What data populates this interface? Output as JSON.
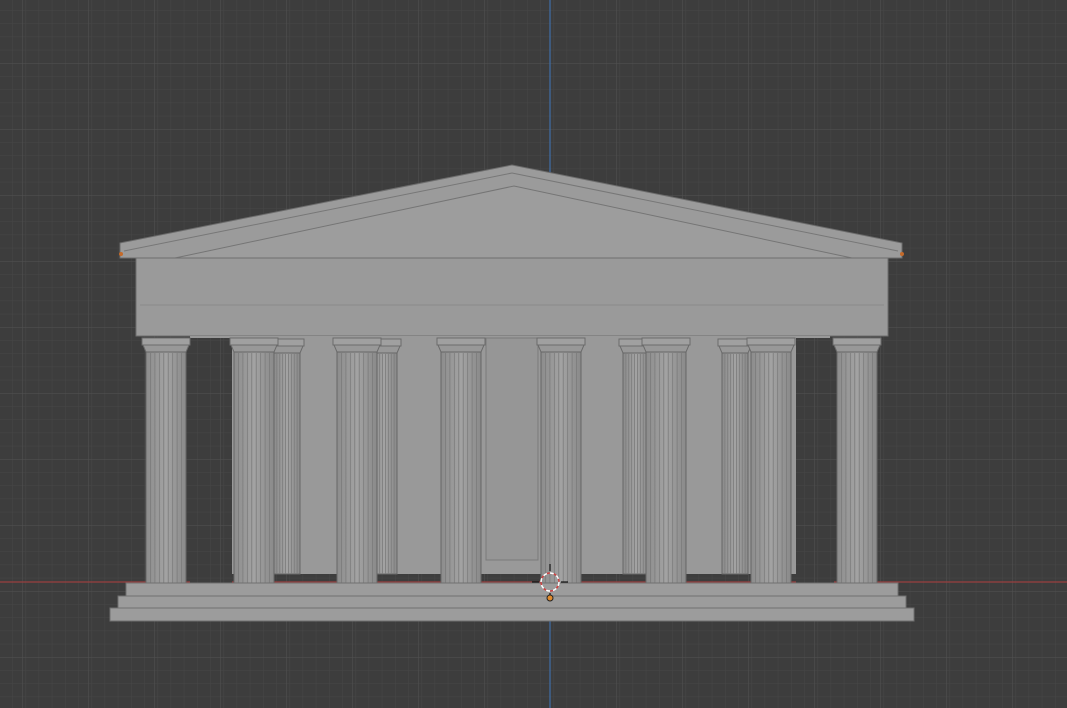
{
  "viewport": {
    "view": "front-orthographic",
    "background_color": "#3d3d3d",
    "grid_minor_color": "#474747",
    "grid_major_color": "#525252",
    "x_axis_color": "#9a3f3f",
    "z_axis_color": "#3f6fa8",
    "grid": true,
    "objects": [
      {
        "name": "temple",
        "type": "mesh",
        "shading": "solid",
        "color": "#9a9a9a",
        "columns_front": 8,
        "columns_back": 4,
        "style": "doric"
      }
    ],
    "icons": [
      "3d-cursor-icon",
      "origin-icon"
    ]
  }
}
